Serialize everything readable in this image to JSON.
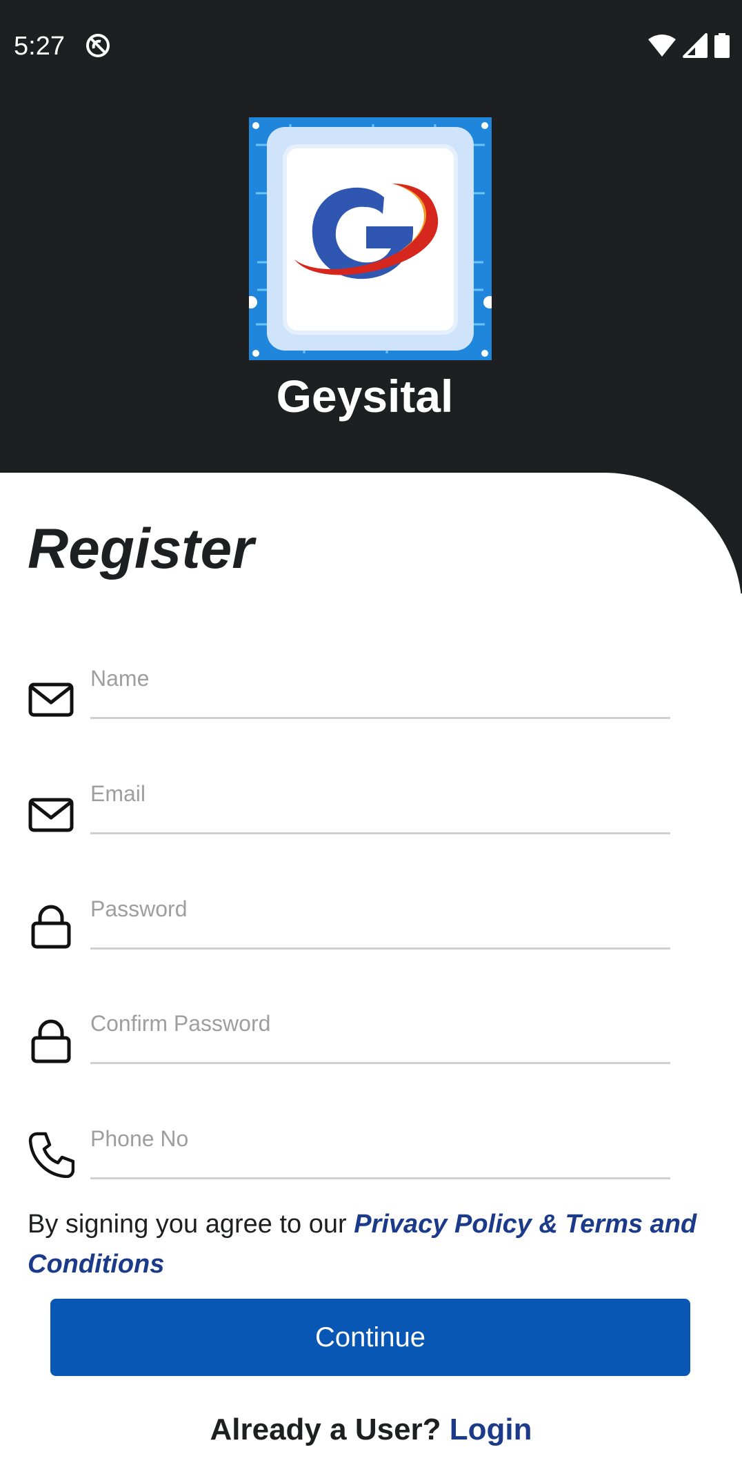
{
  "status_bar": {
    "time": "5:27",
    "icons": [
      "dnd-icon",
      "wifi-icon",
      "signal-icon",
      "battery-icon"
    ]
  },
  "app": {
    "name": "Geysital",
    "logo_icon": "geysital-logo"
  },
  "form": {
    "title": "Register",
    "fields": [
      {
        "icon": "mail-icon",
        "placeholder": "Name",
        "value": ""
      },
      {
        "icon": "mail-icon",
        "placeholder": "Email",
        "value": ""
      },
      {
        "icon": "lock-icon",
        "placeholder": "Password",
        "value": ""
      },
      {
        "icon": "lock-icon",
        "placeholder": "Confirm Password",
        "value": ""
      },
      {
        "icon": "phone-icon",
        "placeholder": "Phone No",
        "value": ""
      }
    ],
    "agree_prefix": "By signing you agree to our ",
    "agree_link": "Privacy Policy & Terms and Conditions",
    "continue_label": "Continue",
    "already_prefix": "Already a User? ",
    "login_label": "Login"
  },
  "colors": {
    "header_bg": "#1e1f20",
    "primary_button": "#0857b5",
    "link": "#1c3a8a",
    "underline": "#cfcfcf"
  }
}
